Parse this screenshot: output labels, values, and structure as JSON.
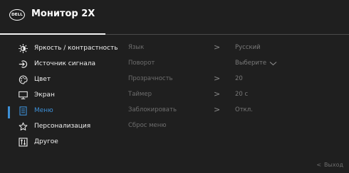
{
  "header": {
    "logo_text": "DELL",
    "title": "Монитор 2X"
  },
  "menu": {
    "items": [
      {
        "label": "Яркость / контрастность",
        "icon": "sun-icon"
      },
      {
        "label": "Источник сигнала",
        "icon": "input-source-icon"
      },
      {
        "label": "Цвет",
        "icon": "palette-icon"
      },
      {
        "label": "Экран",
        "icon": "display-icon"
      },
      {
        "label": "Меню",
        "icon": "menu-doc-icon",
        "active": true
      },
      {
        "label": "Персонализация",
        "icon": "star-icon"
      },
      {
        "label": "Другое",
        "icon": "other-settings-icon"
      }
    ]
  },
  "submenu": {
    "rows": [
      {
        "label": "Язык",
        "arrow": ">",
        "value": "Русский"
      },
      {
        "label": "Поворот",
        "arrow": "",
        "value": "Выберите"
      },
      {
        "label": "Прозрачность",
        "arrow": ">",
        "value": "20"
      },
      {
        "label": "Таймер",
        "arrow": ">",
        "value": "20 с"
      },
      {
        "label": "Заблокировать",
        "arrow": ">",
        "value": "Откл."
      },
      {
        "label": "Сброс меню",
        "arrow": "",
        "value": ""
      }
    ]
  },
  "footer": {
    "exit_chevron": "<",
    "exit_label": "Выход"
  },
  "colors": {
    "accent": "#3d8fd6",
    "background": "#1f1f1f"
  }
}
